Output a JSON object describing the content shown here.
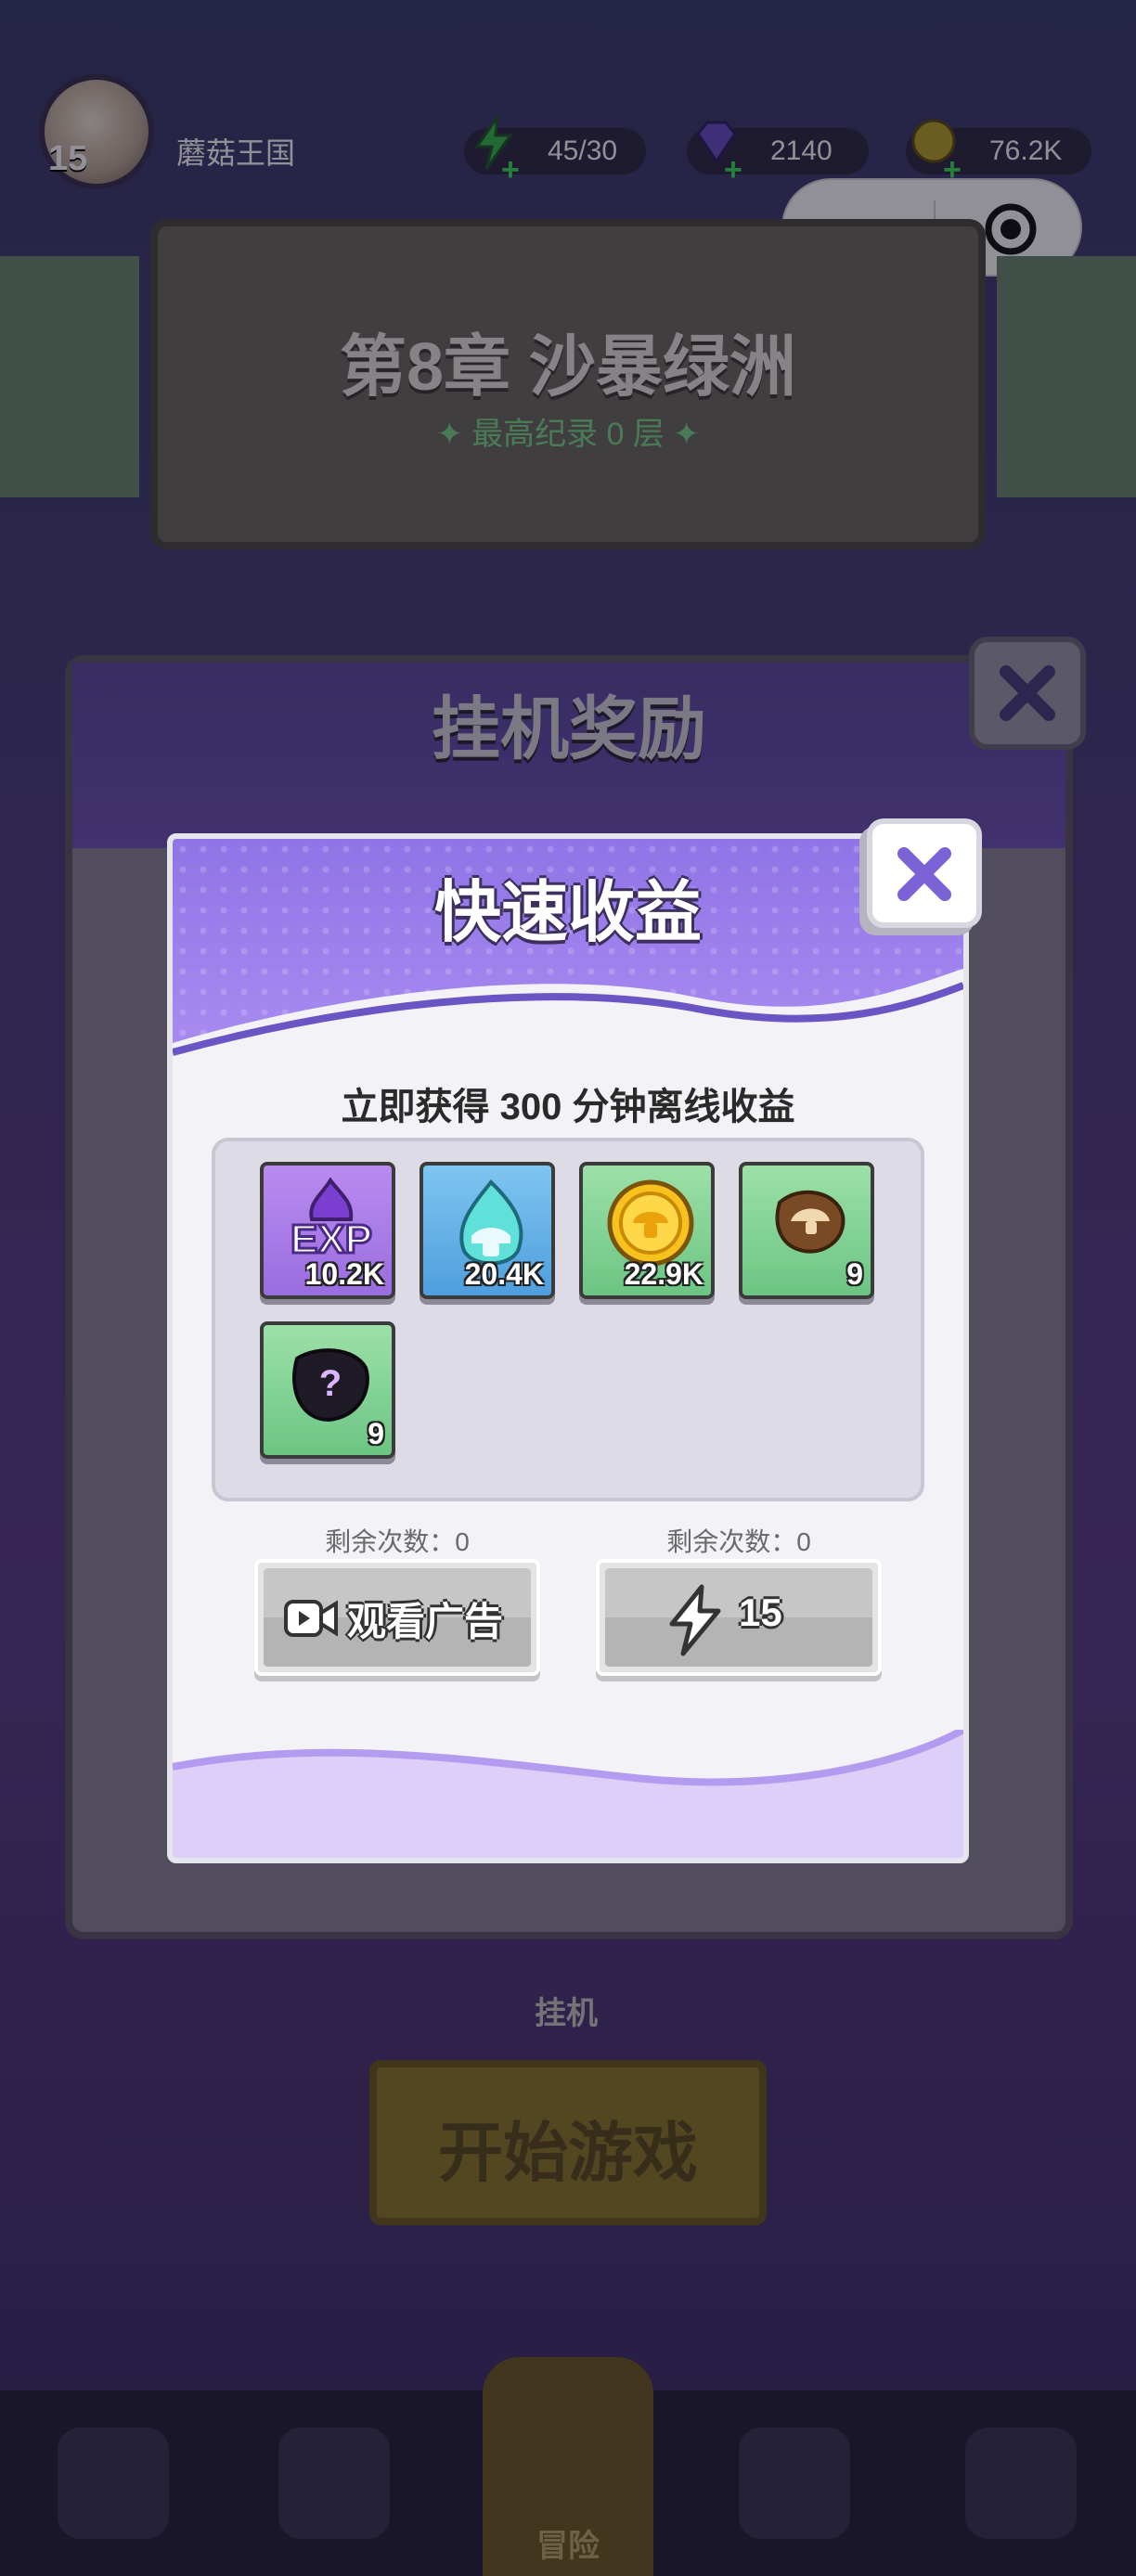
{
  "topbar": {
    "level": "15",
    "player_name": "蘑菇王国",
    "energy": "45/30",
    "gems": "2140",
    "coins": "76.2K"
  },
  "chapter": {
    "title": "第8章 沙暴绿洲",
    "record": "✦ 最高纪录 0 层 ✦"
  },
  "idle_panel": {
    "title": "挂机奖励"
  },
  "home": {
    "idle_label": "挂机",
    "start_label": "开始游戏",
    "adventure_label": "冒险"
  },
  "dialog": {
    "title": "快速收益",
    "offline_text": "立即获得 300 分钟离线收益",
    "rewards": [
      {
        "icon": "exp-icon",
        "count": "10.2K",
        "color": "purple"
      },
      {
        "icon": "spirit-flame-icon",
        "count": "20.4K",
        "color": "blue"
      },
      {
        "icon": "gold-coin-icon",
        "count": "22.9K",
        "color": "green"
      },
      {
        "icon": "mushroom-shard-icon",
        "count": "9",
        "color": "green"
      },
      {
        "icon": "mystery-shard-icon",
        "count": "9",
        "color": "green"
      }
    ],
    "ad_remaining": "剩余次数：0",
    "energy_remaining": "剩余次数：0",
    "watch_ad_label": "观看广告",
    "energy_cost": "15"
  },
  "colors": {
    "dialog_header": "#8f74e6",
    "button_disabled": "#c6c6c6",
    "accent_text": "#2a2a2a"
  }
}
